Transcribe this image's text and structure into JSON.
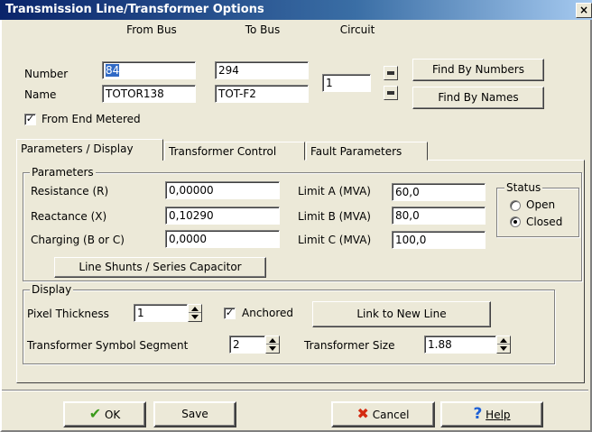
{
  "window": {
    "title": "Transmission Line/Transformer Options",
    "close": "×"
  },
  "header": {
    "from_bus_label": "From Bus",
    "to_bus_label": "To Bus",
    "circuit_label": "Circuit",
    "number_label": "Number",
    "name_label": "Name",
    "from_number": "84",
    "to_number": "294",
    "from_name": "TOTOR138",
    "to_name": "TOT-F2",
    "circuit": "1",
    "find_by_numbers": "Find By Numbers",
    "find_by_names": "Find By Names",
    "from_end_metered": {
      "label": "From End Metered",
      "checked": true
    }
  },
  "tabs": [
    {
      "label": "Parameters / Display",
      "active": true
    },
    {
      "label": "Transformer Control",
      "active": false
    },
    {
      "label": "Fault Parameters",
      "active": false
    }
  ],
  "parameters": {
    "group_title": "Parameters",
    "resistance_label": "Resistance (R)",
    "resistance": "0,00000",
    "reactance_label": "Reactance (X)",
    "reactance": "0,10290",
    "charging_label": "Charging (B or C)",
    "charging": "0,0000",
    "limit_a_label": "Limit A (MVA)",
    "limit_a": "60,0",
    "limit_b_label": "Limit B (MVA)",
    "limit_b": "80,0",
    "limit_c_label": "Limit C (MVA)",
    "limit_c": "100,0",
    "line_shunts_button": "Line Shunts / Series Capacitor",
    "status": {
      "title": "Status",
      "open_label": "Open",
      "closed_label": "Closed",
      "selected": "Closed"
    }
  },
  "display": {
    "group_title": "Display",
    "pixel_thickness_label": "Pixel Thickness",
    "pixel_thickness": "1",
    "anchored_label": "Anchored",
    "anchored_checked": true,
    "link_button": "Link to New Line",
    "symbol_segment_label": "Transformer Symbol Segment",
    "symbol_segment": "2",
    "transformer_size_label": "Transformer Size",
    "transformer_size": "1.88"
  },
  "footer": {
    "ok": "OK",
    "save": "Save",
    "cancel": "Cancel",
    "help": "Help"
  },
  "colors": {
    "ok_check": "#3a9a1a",
    "cancel_x": "#d42a10",
    "help_icon": "#1c5fd6",
    "selection": "#316ac5"
  }
}
